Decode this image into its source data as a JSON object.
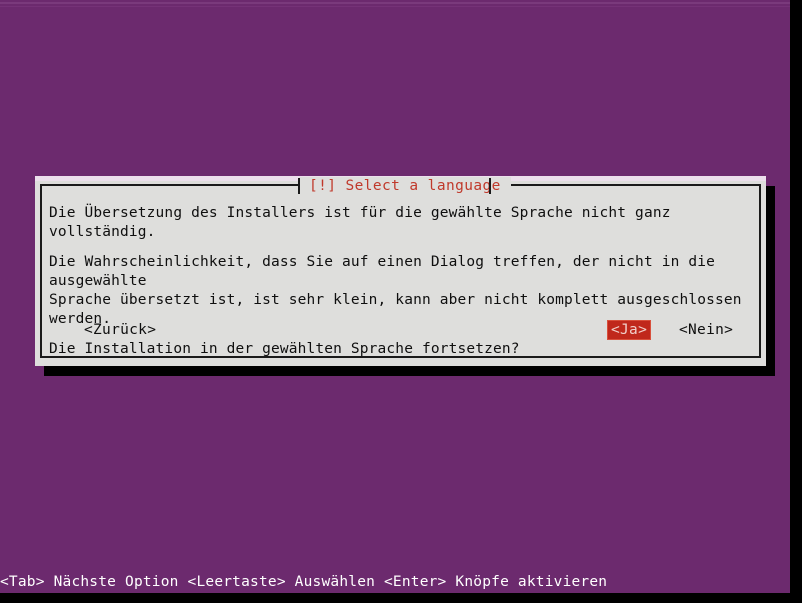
{
  "screen": {
    "background_color": "#6c2a6e",
    "border_color": "#000000"
  },
  "dialog": {
    "title": "[!] Select a language",
    "title_color": "#c0392b",
    "background_color": "#dededc",
    "paragraphs": [
      "Die Übersetzung des Installers ist für die gewählte Sprache nicht ganz vollständig.",
      "Die Wahrscheinlichkeit, dass Sie auf einen Dialog treffen, der nicht in die ausgewählte\nSprache übersetzt ist, ist sehr klein, kann aber nicht komplett ausgeschlossen werden.",
      "Die Installation in der gewählten Sprache fortsetzen?"
    ],
    "buttons": [
      {
        "label": "<Zurück>",
        "selected": false
      },
      {
        "label": "<Ja>",
        "selected": true
      },
      {
        "label": "<Nein>",
        "selected": false
      }
    ],
    "selected_button_bg": "#c0281b",
    "selected_button_fg": "#f0cfc9"
  },
  "footer": {
    "help_line": "<Tab> Nächste Option <Leertaste> Auswählen <Enter> Knöpfe aktivieren",
    "text_color": "#ffffff"
  }
}
